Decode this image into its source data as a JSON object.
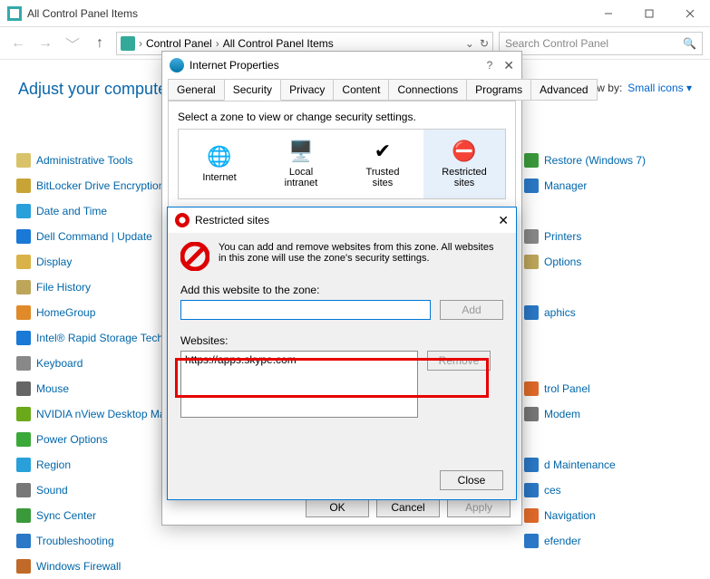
{
  "window": {
    "title": "All Control Panel Items"
  },
  "breadcrumb": {
    "root": "Control Panel",
    "current": "All Control Panel Items"
  },
  "search": {
    "placeholder": "Search Control Panel"
  },
  "adjust_heading": "Adjust your computer'",
  "viewby": {
    "label": "View by:",
    "value": "Small icons"
  },
  "items": {
    "col1": [
      {
        "label": "Administrative Tools",
        "c": "#d9c36a"
      },
      {
        "label": "BitLocker Drive Encryption",
        "c": "#c8a437"
      },
      {
        "label": "Date and Time",
        "c": "#2aa0da"
      },
      {
        "label": "Dell Command | Update",
        "c": "#1a78d6"
      },
      {
        "label": "Display",
        "c": "#d9b24a"
      },
      {
        "label": "File History",
        "c": "#bda65a"
      },
      {
        "label": "HomeGroup",
        "c": "#e08a2a"
      },
      {
        "label": "Intel® Rapid Storage Tech",
        "c": "#1a78d6"
      },
      {
        "label": "Keyboard",
        "c": "#888"
      },
      {
        "label": "Mouse",
        "c": "#666"
      },
      {
        "label": "NVIDIA nView Desktop Ma",
        "c": "#6aa91a"
      },
      {
        "label": "Power Options",
        "c": "#3aa93a"
      },
      {
        "label": "Region",
        "c": "#2aa0da"
      },
      {
        "label": "Sound",
        "c": "#777"
      },
      {
        "label": "Sync Center",
        "c": "#3a9a3a"
      },
      {
        "label": "Troubleshooting",
        "c": "#2a78c6"
      },
      {
        "label": "Windows Firewall",
        "c": "#c06a2a"
      }
    ],
    "col3": [
      {
        "label": "Restore (Windows 7)",
        "c": "#3a9a3a"
      },
      {
        "label": "Manager",
        "c": "#2a78c6"
      },
      {
        "label": "",
        "c": ""
      },
      {
        "label": "Printers",
        "c": "#888"
      },
      {
        "label": "Options",
        "c": "#bda65a"
      },
      {
        "label": "",
        "c": ""
      },
      {
        "label": "aphics",
        "c": "#2a78c6"
      },
      {
        "label": "",
        "c": ""
      },
      {
        "label": "",
        "c": ""
      },
      {
        "label": "trol Panel",
        "c": "#e06a2a"
      },
      {
        "label": "Modem",
        "c": "#777"
      },
      {
        "label": "",
        "c": ""
      },
      {
        "label": "d Maintenance",
        "c": "#2a78c6"
      },
      {
        "label": "ces",
        "c": "#2a78c6"
      },
      {
        "label": "Navigation",
        "c": "#e06a2a"
      },
      {
        "label": "efender",
        "c": "#2a78c6"
      },
      {
        "label": "",
        "c": ""
      }
    ]
  },
  "dialog": {
    "title": "Internet Properties",
    "tabs": [
      "General",
      "Security",
      "Privacy",
      "Content",
      "Connections",
      "Programs",
      "Advanced"
    ],
    "active_tab": "Security",
    "zone_label": "Select a zone to view or change security settings.",
    "zones": [
      "Internet",
      "Local intranet",
      "Trusted sites",
      "Restricted sites"
    ],
    "buttons": {
      "ok": "OK",
      "cancel": "Cancel",
      "apply": "Apply"
    }
  },
  "subdialog": {
    "title": "Restricted sites",
    "description": "You can add and remove websites from this zone. All websites in this zone will use the zone's security settings.",
    "add_label": "Add this website to the zone:",
    "add_btn": "Add",
    "websites_label": "Websites:",
    "websites": [
      "https://apps.skype.com"
    ],
    "remove_btn": "Remove",
    "close_btn": "Close"
  }
}
